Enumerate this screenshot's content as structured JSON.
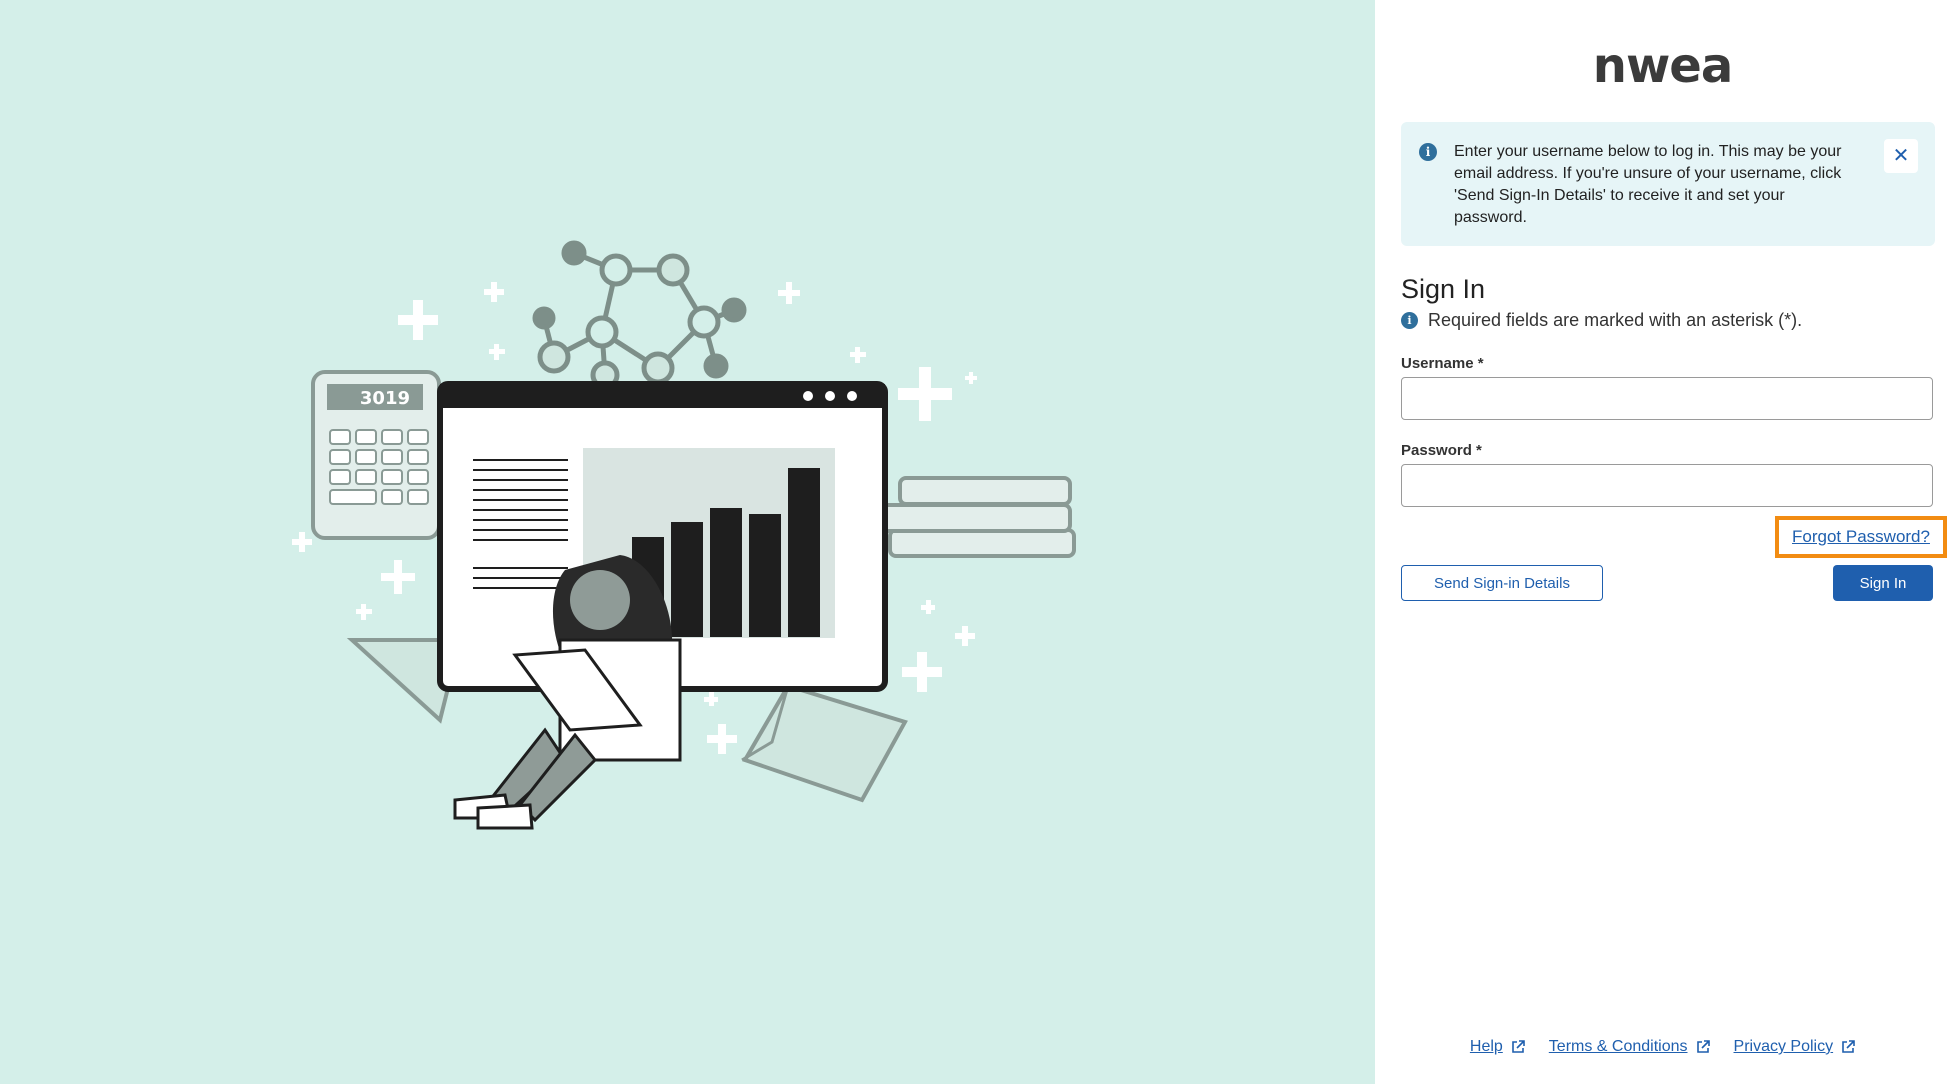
{
  "brand": {
    "logo_text": "nwea"
  },
  "alert": {
    "icon": "info-icon",
    "message": "Enter your username below to log in. This may be your email address. If you're unsure of your username, click 'Send Sign-In Details' to receive it and set your password.",
    "close_icon": "close-icon"
  },
  "form": {
    "title": "Sign In",
    "required_note": "Required fields are marked with an asterisk (*).",
    "username_label": "Username *",
    "username_value": "",
    "password_label": "Password *",
    "password_value": "",
    "forgot_password": "Forgot Password?",
    "send_details_button": "Send Sign-in Details",
    "sign_in_button": "Sign In"
  },
  "footer": {
    "links": [
      "Help",
      "Terms & Conditions",
      "Privacy Policy"
    ],
    "link_icon": "external-link-icon"
  },
  "colors": {
    "hero_bg": "#d4efe9",
    "accent": "#1f5fae",
    "highlight": "#f28c12",
    "alert_bg": "#e6f5f7"
  },
  "illustration": {
    "calculator_display": "3019"
  }
}
